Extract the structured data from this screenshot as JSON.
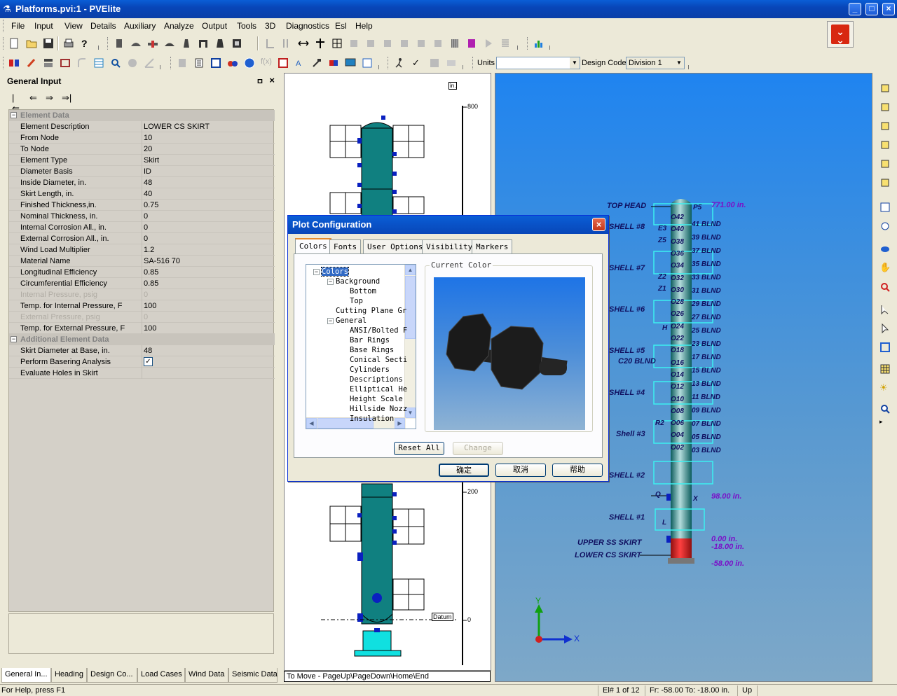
{
  "window": {
    "title": "Platforms.pvi:1 - PVElite",
    "buttons": {
      "minimize": "_",
      "maximize": "□",
      "close": "×"
    }
  },
  "menu": [
    "File",
    "Input",
    "View",
    "Details",
    "Auxiliary",
    "Analyze",
    "Output",
    "Tools",
    "3D",
    "Diagnostics",
    "Esl",
    "Help"
  ],
  "toolbar": {
    "units_label": "Units",
    "units_value": "",
    "design_code_label": "Design Code",
    "design_code_value": "Division 1"
  },
  "general_input": {
    "title": "General Input",
    "pin": "ㅁ",
    "close": "×",
    "nav": [
      "|⇐",
      "⇐",
      "⇒",
      "⇒|"
    ],
    "rows": [
      {
        "type": "cat",
        "label": "Element Data",
        "exp": "−"
      },
      {
        "label": "Element Description",
        "value": "LOWER CS SKIRT"
      },
      {
        "label": "From Node",
        "value": "10"
      },
      {
        "label": "To Node",
        "value": "20"
      },
      {
        "label": "Element Type",
        "value": "Skirt"
      },
      {
        "label": "Diameter Basis",
        "value": "ID"
      },
      {
        "label": "Inside Diameter, in.",
        "value": "48"
      },
      {
        "label": "Skirt Length, in.",
        "value": "40"
      },
      {
        "label": "Finished Thickness,in.",
        "value": "0.75"
      },
      {
        "label": "Nominal Thickness, in.",
        "value": "0"
      },
      {
        "label": "Internal Corrosion All., in.",
        "value": "0"
      },
      {
        "label": "External Corrosion All., in.",
        "value": "0"
      },
      {
        "label": "Wind Load Multiplier",
        "value": "1.2"
      },
      {
        "label": "Material Name",
        "value": "SA-516 70"
      },
      {
        "label": "Longitudinal Efficiency",
        "value": "0.85"
      },
      {
        "label": "Circumferential Efficiency",
        "value": "0.85"
      },
      {
        "type": "disabled",
        "label": "Internal Pressure, psig",
        "value": "0"
      },
      {
        "label": "Temp. for Internal Pressure, F",
        "value": "100"
      },
      {
        "type": "disabled",
        "label": "External Pressure, psig",
        "value": "0"
      },
      {
        "label": "Temp. for External Pressure, F",
        "value": "100"
      },
      {
        "type": "cat",
        "label": "Additional Element Data",
        "exp": "−"
      },
      {
        "label": "Skirt Diameter at Base, in.",
        "value": "48"
      },
      {
        "type": "check",
        "label": "Perform Basering Analysis",
        "value": "✓"
      },
      {
        "label": "Evaluate Holes in Skirt",
        "value": ""
      }
    ]
  },
  "bottom_tabs": [
    "General In...",
    "Heading",
    "Design Co...",
    "Load Cases",
    "Wind Data",
    "Seismic Data"
  ],
  "drawing": {
    "unit": "in.",
    "scale": [
      "800",
      "200",
      "0"
    ],
    "datum": "Datum",
    "hint": "To Move - PageUp\\PageDown\\Home\\End"
  },
  "view3d": {
    "labels": [
      "TOP HEAD",
      "SHELL #8",
      "SHELL #7",
      "SHELL #6",
      "SHELL #5",
      "C20 BLND",
      "SHELL #4",
      "Shell #3",
      "SHELL #2",
      "SHELL #1",
      "UPPER SS SKIRT",
      "LOWER CS SKIRT"
    ],
    "elevations": [
      "771.00 in.",
      "98.00 in.",
      "0.00 in.",
      "-18.00 in.",
      "-58.00 in."
    ],
    "nozzles": [
      "O42",
      "O40",
      "O38",
      "O36",
      "O34",
      "O32",
      "O30",
      "O28",
      "O26",
      "O24",
      "O22",
      "O18",
      "O16",
      "O14",
      "O12",
      "O10",
      "O08",
      "O06",
      "O04",
      "O02"
    ],
    "blinds": [
      "41 BLND",
      "39 BLND",
      "37 BLND",
      "35 BLND",
      "33 BLND",
      "31 BLND",
      "29 BLND",
      "27 BLND",
      "25 BLND",
      "23 BLND",
      "17 BLND",
      "15 BLND",
      "13 BLND",
      "11 BLND",
      "09 BLND",
      "07 BLND",
      "05 BLND",
      "03 BLND"
    ],
    "tags": [
      "P5",
      "E3",
      "Z5",
      "Z2",
      "Z1",
      "H",
      "R2",
      "Q",
      "X",
      "L"
    ],
    "axis_x": "X",
    "axis_y": "Y"
  },
  "statusbar": {
    "help": "For Help, press F1",
    "element": "El# 1 of 12",
    "range": "Fr: -58.00 To: -18.00 in.",
    "direction": "Up"
  },
  "dialog": {
    "title": "Plot Configuration",
    "close": "×",
    "tabs": [
      "Colors",
      "Fonts",
      "User Options",
      "Visibility",
      "Markers"
    ],
    "active_tab": "Colors",
    "tree": [
      {
        "text": "Colors",
        "level": 0,
        "exp": "−",
        "selected": true
      },
      {
        "text": "Background",
        "level": 1,
        "exp": "−"
      },
      {
        "text": "Bottom",
        "level": 2
      },
      {
        "text": "Top",
        "level": 2
      },
      {
        "text": "Cutting Plane Gr",
        "level": 1
      },
      {
        "text": "General",
        "level": 1,
        "exp": "−"
      },
      {
        "text": "ANSI/Bolted F",
        "level": 2
      },
      {
        "text": "Bar Rings",
        "level": 2
      },
      {
        "text": "Base Rings",
        "level": 2
      },
      {
        "text": "Conical Secti",
        "level": 2
      },
      {
        "text": "Cylinders",
        "level": 2
      },
      {
        "text": "Descriptions",
        "level": 2
      },
      {
        "text": "Elliptical He",
        "level": 2
      },
      {
        "text": "Height Scale",
        "level": 2
      },
      {
        "text": "Hillside Nozz",
        "level": 2
      },
      {
        "text": "Insulation",
        "level": 2
      }
    ],
    "current_color_title": "Current Color",
    "reset_all": "Reset All",
    "change": "Change",
    "ok": "确定",
    "cancel": "取消",
    "help": "帮助"
  },
  "colors": {
    "accent": "#0a5ed6",
    "vessel": "#108080",
    "skirt_red": "#d81010",
    "annotation": "#7a10c8"
  }
}
